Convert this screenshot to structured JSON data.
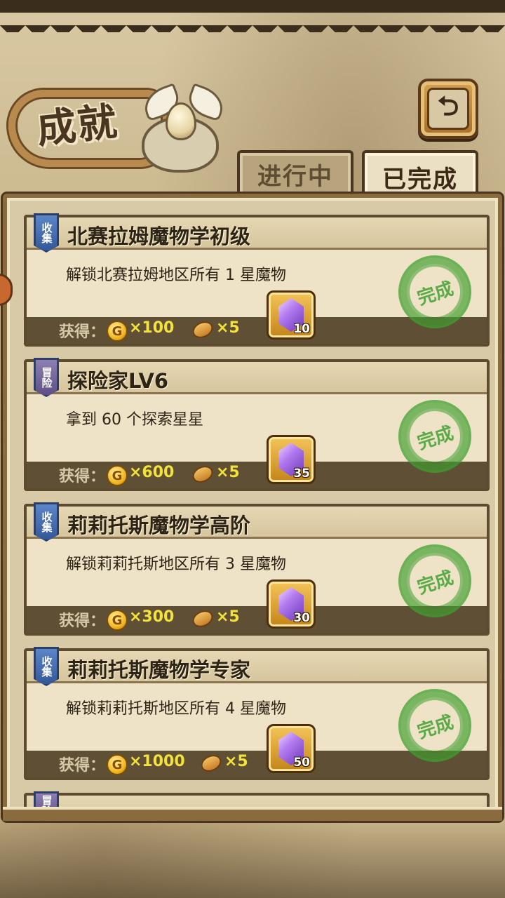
{
  "header": {
    "title": "成就",
    "back_icon": "back-arrow-icon"
  },
  "tabs": [
    {
      "label": "进行中",
      "active": false
    },
    {
      "label": "已完成",
      "active": true
    }
  ],
  "reward_label": "获得：",
  "stamp_text": "完成",
  "cards": [
    {
      "badge": "收集",
      "badge_color": "#4a74b8",
      "title": "北赛拉姆魔物学初级",
      "desc": "解锁北赛拉姆地区所有 1 星魔物",
      "coins": "×100",
      "bread": "×5",
      "gems": "10"
    },
    {
      "badge": "冒险",
      "badge_color": "#7a6ba2",
      "title": "探险家LV6",
      "desc": "拿到 60 个探索星星",
      "coins": "×600",
      "bread": "×5",
      "gems": "35"
    },
    {
      "badge": "收集",
      "badge_color": "#4a74b8",
      "title": "莉莉托斯魔物学高阶",
      "desc": "解锁莉莉托斯地区所有 3 星魔物",
      "coins": "×300",
      "bread": "×5",
      "gems": "30"
    },
    {
      "badge": "收集",
      "badge_color": "#4a74b8",
      "title": "莉莉托斯魔物学专家",
      "desc": "解锁莉莉托斯地区所有 4 星魔物",
      "coins": "×1000",
      "bread": "×5",
      "gems": "50"
    }
  ],
  "partial_card": {
    "badge": "冒险"
  }
}
